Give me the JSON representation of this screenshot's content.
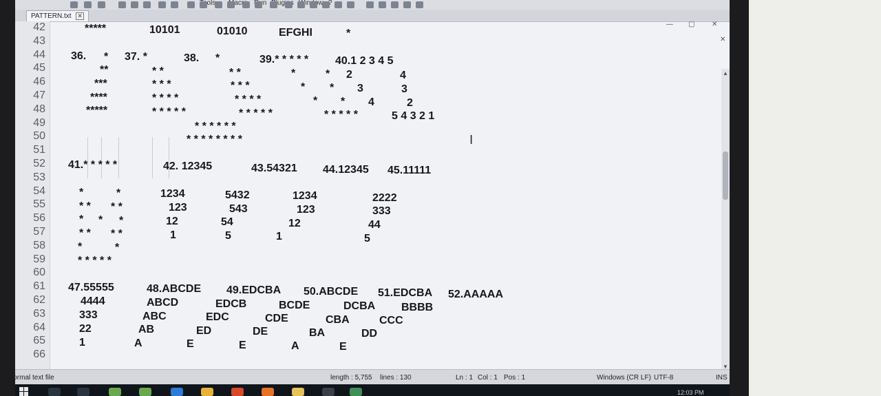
{
  "window": {
    "tab_label": "PATTERN.txt",
    "menu": [
      "Tools",
      "Macro",
      "Run",
      "Plugins",
      "Window",
      "?"
    ],
    "close_glyph": "✕",
    "restore_glyph": "▢",
    "minimize_glyph": "—"
  },
  "editor": {
    "line_numbers": [
      "42",
      "43",
      "44",
      "45",
      "46",
      "47",
      "48",
      "49",
      "50",
      "51",
      "52",
      "53",
      "54",
      "55",
      "56",
      "57",
      "58",
      "59",
      "60",
      "61",
      "62",
      "63",
      "64",
      "65",
      "66"
    ],
    "lines": [
      [
        "*****",
        "10101",
        "01010",
        "EFGHI",
        "*"
      ],
      [
        "36.",
        "*",
        "37. *",
        "38.",
        "*",
        "39.* * * * *",
        "40.1 2 3 4 5"
      ],
      [
        "**",
        "* *",
        "* *",
        "*",
        "*",
        "2",
        "4"
      ],
      [
        "***",
        "* * *",
        "* * *",
        "*",
        "*",
        "3",
        "3"
      ],
      [
        "****",
        "* * * *",
        "* * * *",
        "*",
        "*",
        "4",
        "2"
      ],
      [
        "*****",
        "* * * * *",
        "* * * * *",
        "* * * * *",
        "5 4 3 2 1"
      ],
      [
        "* * * * * *"
      ],
      [
        "* * * * * * * *"
      ],
      [
        "41.* * * * *",
        "42. 12345",
        "43.54321",
        "44.12345",
        "45.11111"
      ],
      [
        "*",
        "*",
        "1234",
        "5432",
        "1234",
        "2222"
      ],
      [
        "* *",
        "* *",
        "123",
        "543",
        "123",
        "333"
      ],
      [
        "*",
        "*",
        "*",
        "12",
        "54",
        "12",
        "44"
      ],
      [
        "* *",
        "* *",
        "1",
        "5",
        "1",
        "5"
      ],
      [
        "*",
        "*"
      ],
      [
        "* * * * *"
      ],
      [
        "47.55555",
        "48.ABCDE",
        "49.EDCBA",
        "50.ABCDE",
        "51.EDCBA",
        "52.AAAAA"
      ],
      [
        "4444",
        "ABCD",
        "EDCB",
        "BCDE",
        "DCBA",
        "BBBB"
      ],
      [
        "333",
        "ABC",
        "EDC",
        "CDE",
        "CBA",
        "CCC"
      ],
      [
        "22",
        "AB",
        "ED",
        "DE",
        "BA",
        "DD"
      ],
      [
        "1",
        "A",
        "E",
        "E",
        "A",
        "E"
      ]
    ]
  },
  "statusbar": {
    "file_type": "Normal text file",
    "length": "length : 5,755",
    "lines": "lines : 130",
    "ln": "Ln : 1",
    "col": "Col : 1",
    "pos": "Pos : 1",
    "eol": "Windows (CR LF)",
    "encoding": "UTF-8",
    "mode": "INS"
  },
  "taskbar": {
    "clock": "12:03 PM"
  },
  "icons": {
    "cursor": "ibeam-cursor-icon",
    "start": "windows-start-icon",
    "search": "search-icon",
    "task_view": "task-view-icon"
  }
}
